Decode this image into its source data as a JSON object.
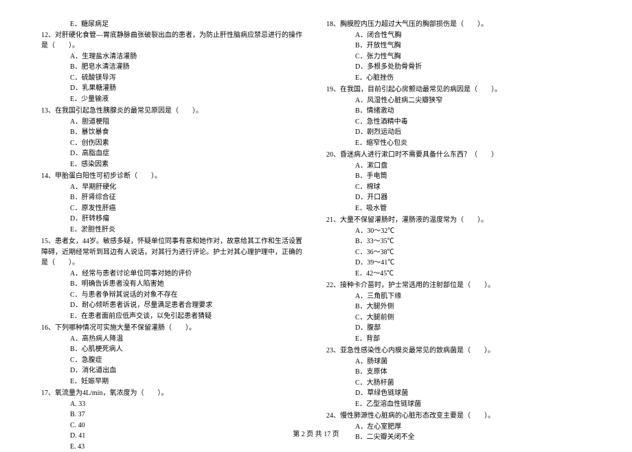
{
  "left_column": {
    "q11_tail_option": "E．糖尿病足",
    "q12": {
      "stem": "12、对肝硬化食管—胃底静脉曲张破裂出血的患者，为防止肝性脑病应禁忌进行的操作是（　　）。",
      "options": [
        "A．生理盐水清洁灌肠",
        "B．肥皂水清洁灌肠",
        "C．硫酸镁导泻",
        "D．乳果糖灌肠",
        "E．少量输液"
      ]
    },
    "q13": {
      "stem": "13、在我国引起急性胰腺炎的最常见原因是（　　）。",
      "options": [
        "A．胆道梗阻",
        "B．暴饮暴食",
        "C．创伤因素",
        "D．高脂血症",
        "E．感染因素"
      ]
    },
    "q14": {
      "stem": "14、甲胎蛋白阳性可初步诊断（　　）。",
      "options": [
        "A．早期肝硬化",
        "B．肝肾综合征",
        "C．原发性肝癌",
        "D．肝转移瘤",
        "E．淤胆性肝炎"
      ]
    },
    "q15": {
      "stem": "15、患者女，44岁。敏感多疑，怀疑单位同事有意和她作对，故意给其工作和生活设置障碍，近期经常听到耳边有人说话，对其行为进行评论。护士对其心理护理中，正确的是（　　）。",
      "options": [
        "A．经常与患者讨论单位同事对她的评价",
        "B．明确告诉患者没有人陷害她",
        "C．与患者争辩其说话的对象不存在",
        "D．耐心倾听患者诉说，尽量满足患者合理要求",
        "E．在患者面前应低声交谈，以免引起患者猜疑"
      ]
    },
    "q16": {
      "stem": "16、下列哪种情况可实施大量不保留灌肠（　　）。",
      "options": [
        "A．高热病人降温",
        "B．心肌梗死病人",
        "C．急腹症",
        "D．消化道出血",
        "E．妊娠早期"
      ]
    },
    "q17": {
      "stem": "17、氧流量为4L/min，氧浓度为（　　）。",
      "options": [
        "A. 33",
        "B. 37",
        "C. 40",
        "D. 41",
        "E. 43"
      ]
    }
  },
  "right_column": {
    "q18": {
      "stem": "18、胸膜腔内压力超过大气压的胸部损伤是（　　）。",
      "options": [
        "A．闭合性气胸",
        "B．开放性气胸",
        "C．张力性气胸",
        "D．多根多处肋骨骨折",
        "E．心脏挫伤"
      ]
    },
    "q19": {
      "stem": "19、在我国，目前引起心房颤动最常见的病因是（　　）。",
      "options": [
        "A．风湿性心脏病二尖瓣狭窄",
        "B．情绪激动",
        "C．急性酒精中毒",
        "D．剧烈运动后",
        "E．缩窄性心包炎"
      ]
    },
    "q20": {
      "stem": "20、昏迷病人进行漱口时不需要具备什么东西？（　　）",
      "options": [
        "A．漱口盘",
        "B．手电筒",
        "C．棉球",
        "D．开口器",
        "E．吸水管"
      ]
    },
    "q21": {
      "stem": "21、大量不保留灌肠时，灌肠液的温度常为（　　）。",
      "options": [
        "A．30～32℃",
        "B．33～35℃",
        "C．36～38℃",
        "D．39～41℃",
        "E．42～45℃"
      ]
    },
    "q22": {
      "stem": "22、接种卡介苗时，护士常选用的注射部位是（　　）。",
      "options": [
        "A．三角肌下缘",
        "B．大腿外侧",
        "C．大腿前侧",
        "D．腹部",
        "E．背部"
      ]
    },
    "q23": {
      "stem": "23、亚急性感染性心内膜炎最常见的致病菌是（　　）。",
      "options": [
        "A．肠球菌",
        "B．支原体",
        "C．大肠杆菌",
        "D．草绿色链球菌",
        "E．乙型溶血性链球菌"
      ]
    },
    "q24": {
      "stem": "24、慢性肺源性心脏病的心脏形态改变主要是（　　）。",
      "options": [
        "A．左心室肥厚",
        "B．二尖瓣关闭不全"
      ]
    }
  },
  "footer": "第 2 页 共 17 页"
}
